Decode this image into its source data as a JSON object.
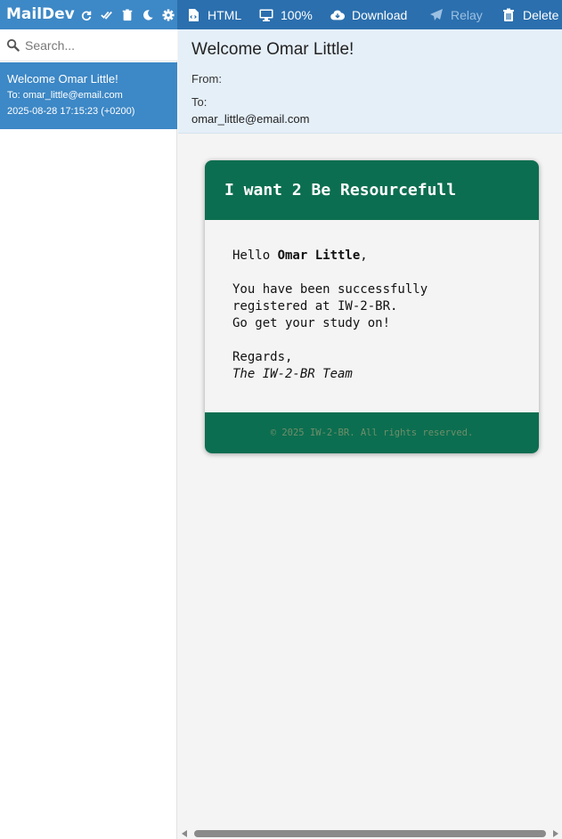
{
  "app": {
    "name": "MailDev",
    "version": "1",
    "brand_icons": [
      "refresh-icon",
      "double-check-icon",
      "trash-icon",
      "moon-icon",
      "gear-icon"
    ]
  },
  "search": {
    "placeholder": "Search...",
    "value": ""
  },
  "mail_list": [
    {
      "subject": "Welcome Omar Little!",
      "to": "To: omar_little@email.com",
      "date": "2025-08-28 17:15:23 (+0200)"
    }
  ],
  "toolbar": {
    "html_label": "HTML",
    "zoom_label": "100%",
    "download_label": "Download",
    "relay_label": "Relay",
    "delete_label": "Delete"
  },
  "header": {
    "title": "Welcome Omar Little!",
    "from_label": "From:",
    "to_label": "To:",
    "to_value": "omar_little@email.com"
  },
  "email": {
    "heading": "I want 2 Be Resourcefull",
    "greeting_prefix": "Hello ",
    "greeting_name": "Omar Little",
    "greeting_suffix": ",",
    "line1": "You have been successfully",
    "line2": "registered at IW-2-BR.",
    "line3": "Go get your study on!",
    "regards": "Regards,",
    "signature": "The IW-2-BR Team",
    "footer": "© 2025 IW-2-BR. All rights reserved."
  },
  "colors": {
    "brand_blue": "#3d88c6",
    "toolbar_blue": "#2b6fae",
    "header_bg": "#e5eff8",
    "email_green": "#0c6e50"
  }
}
